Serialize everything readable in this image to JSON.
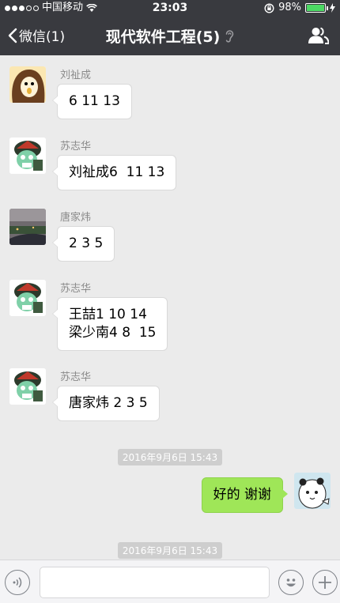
{
  "status_bar": {
    "carrier": "中国移动",
    "time": "23:03",
    "battery": "98%",
    "battery_level": 0.98
  },
  "header": {
    "back_label": "微信(1)",
    "title": "现代软件工程(5)"
  },
  "messages": [
    {
      "sender": "刘祉成",
      "lines": [
        "6 11 13"
      ]
    },
    {
      "sender": "苏志华",
      "lines": [
        "刘祉成6  11 13"
      ]
    },
    {
      "sender": "唐家炜",
      "lines": [
        "2 3 5"
      ]
    },
    {
      "sender": "苏志华",
      "lines": [
        "王喆1 10 14",
        "梁少南4 8  15"
      ]
    },
    {
      "sender": "苏志华",
      "lines": [
        "唐家炜 2 3 5"
      ]
    }
  ],
  "timestamps": [
    "2016年9月6日 15:43",
    "2016年9月6日 15:43"
  ],
  "my_message": "好的 谢谢",
  "input": {
    "value": ""
  },
  "colors": {
    "header_bg": "#393a3f",
    "chat_bg": "#ebebeb",
    "my_bubble": "#9fe658",
    "battery_fill": "#4cd964"
  }
}
